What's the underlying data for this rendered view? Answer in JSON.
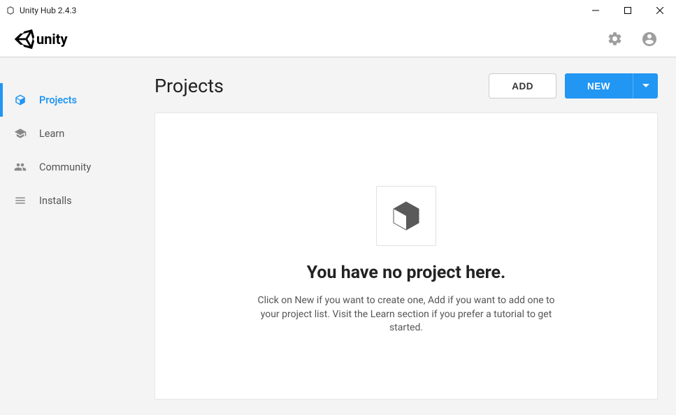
{
  "window": {
    "title": "Unity Hub 2.4.3"
  },
  "topbar": {
    "brand": "unity"
  },
  "sidebar": {
    "items": [
      {
        "label": "Projects"
      },
      {
        "label": "Learn"
      },
      {
        "label": "Community"
      },
      {
        "label": "Installs"
      }
    ]
  },
  "main": {
    "title": "Projects",
    "add_label": "ADD",
    "new_label": "NEW",
    "empty": {
      "title": "You have no project here.",
      "desc": "Click on New if you want to create one, Add if you want to add one to your project list. Visit the Learn section if you prefer a tutorial to get started."
    }
  }
}
